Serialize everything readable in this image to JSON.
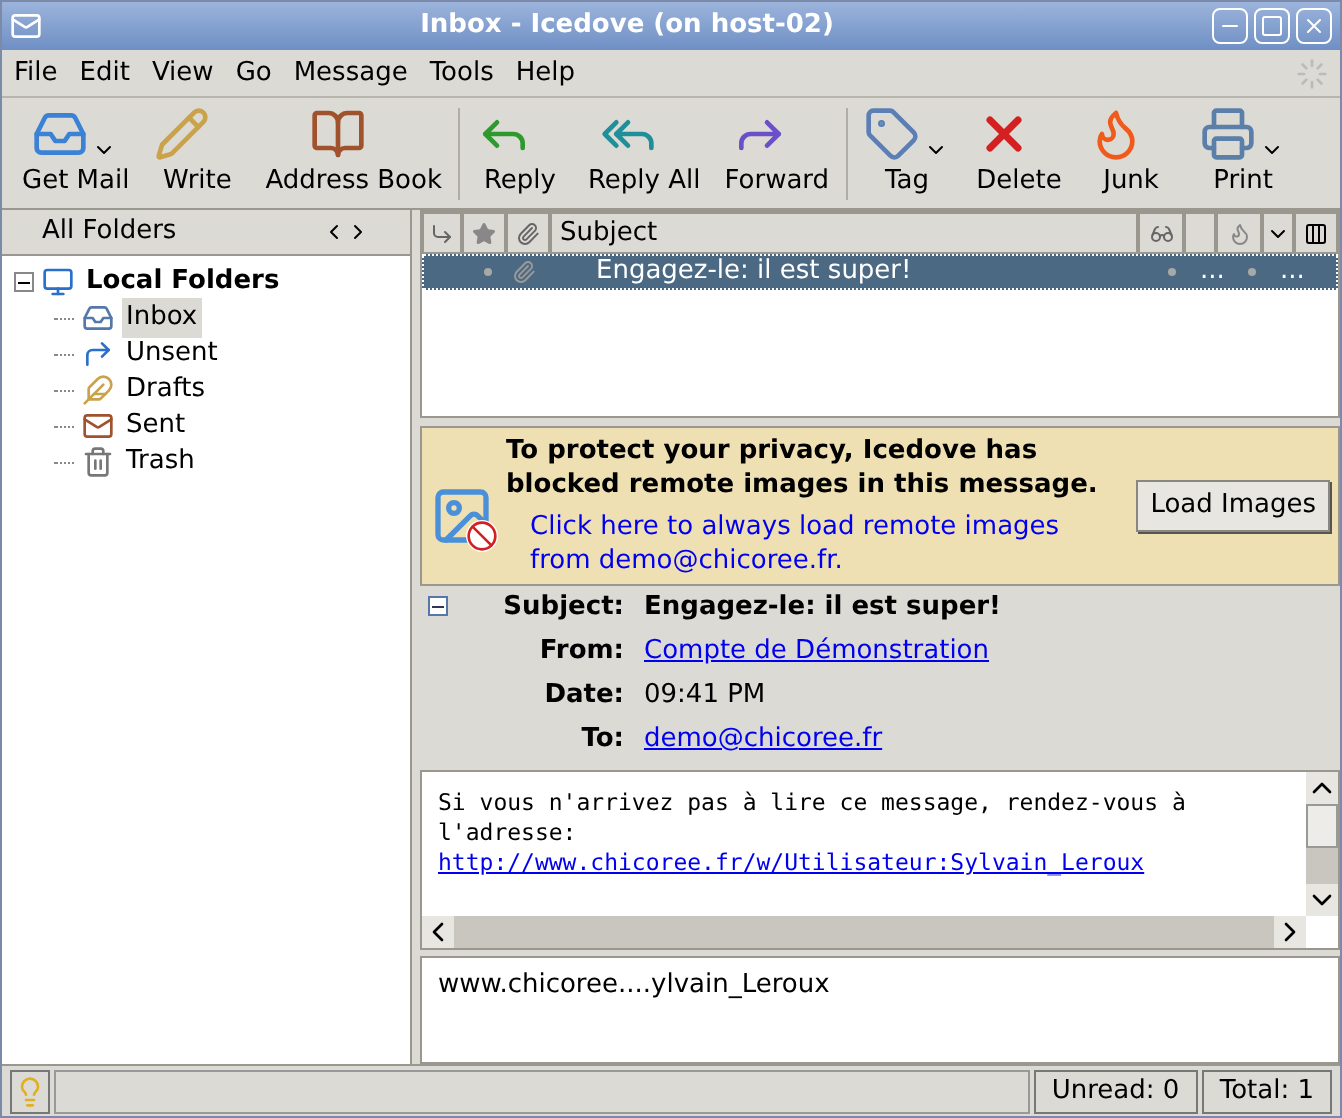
{
  "window": {
    "title": "Inbox - Icedove (on host-02)"
  },
  "menu": [
    "File",
    "Edit",
    "View",
    "Go",
    "Message",
    "Tools",
    "Help"
  ],
  "toolbar": [
    {
      "kind": "button",
      "label": "Get Mail",
      "dropdown": true
    },
    {
      "kind": "button",
      "label": "Write",
      "dropdown": false
    },
    {
      "kind": "button",
      "label": "Address Book",
      "dropdown": false
    },
    {
      "kind": "separator"
    },
    {
      "kind": "button",
      "label": "Reply",
      "dropdown": false
    },
    {
      "kind": "button",
      "label": "Reply All",
      "dropdown": false
    },
    {
      "kind": "button",
      "label": "Forward",
      "dropdown": false
    },
    {
      "kind": "separator"
    },
    {
      "kind": "button",
      "label": "Tag",
      "dropdown": true
    },
    {
      "kind": "button",
      "label": "Delete",
      "dropdown": false
    },
    {
      "kind": "button",
      "label": "Junk",
      "dropdown": false
    },
    {
      "kind": "button",
      "label": "Print",
      "dropdown": true
    }
  ],
  "folder_pane": {
    "header": "All Folders",
    "tree": [
      {
        "label": "Local Folders",
        "expanded": true,
        "selected": false,
        "children": [
          {
            "label": "Inbox",
            "selected": true
          },
          {
            "label": "Unsent",
            "selected": false
          },
          {
            "label": "Drafts",
            "selected": false
          },
          {
            "label": "Sent",
            "selected": false
          },
          {
            "label": "Trash",
            "selected": false
          }
        ]
      }
    ]
  },
  "thread_pane": {
    "subject_column": "Subject",
    "rows": [
      {
        "subject": "Engagez-le: il est super!",
        "column_5": "...",
        "column_6": "...",
        "selected": true
      }
    ]
  },
  "remote_content_bar": {
    "message": "To protect your privacy, Icedove has blocked remote images in this message.",
    "link": "Click here to always load remote images from demo@chicoree.fr.",
    "button": "Load Images"
  },
  "headers": {
    "expanded": true,
    "fields": [
      {
        "label": "Subject:",
        "value": "Engagez-le: il est super!",
        "kind": "bold"
      },
      {
        "label": "From:",
        "value": "Compte de Démonstration",
        "kind": "link"
      },
      {
        "label": "Date:",
        "value": "09:41 PM",
        "kind": "text"
      },
      {
        "label": "To:",
        "value": "demo@chicoree.fr",
        "kind": "link"
      }
    ]
  },
  "body": {
    "lines": [
      {
        "kind": "text",
        "text": "Si vous n'arrivez pas à lire ce message, rendez-vous à"
      },
      {
        "kind": "text",
        "text": "l'adresse:"
      },
      {
        "kind": "link",
        "text": "http://www.chicoree.fr/w/Utilisateur:Sylvain_Leroux"
      }
    ]
  },
  "link_preview": "www.chicoree....ylvain_Leroux",
  "status_bar": {
    "unread": "Unread: 0",
    "total": "Total: 1"
  }
}
